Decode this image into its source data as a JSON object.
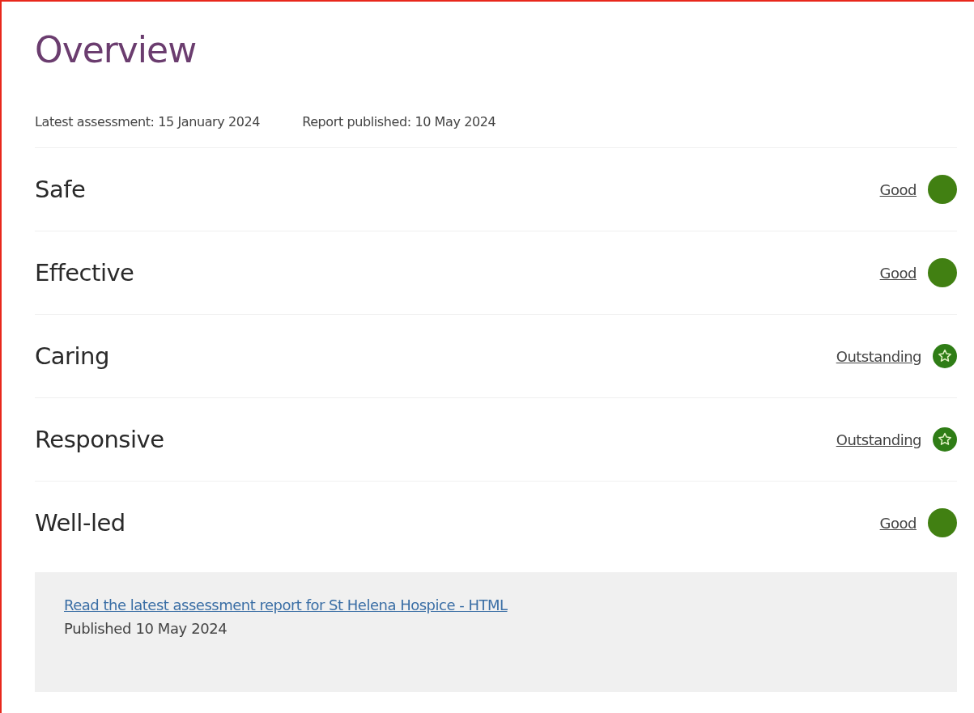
{
  "title": "Overview",
  "meta": [
    "Latest assessment: 15 January 2024",
    "Report published: 10 May 2024"
  ],
  "ratings": [
    {
      "area": "Safe",
      "rating": "Good",
      "kind": "good"
    },
    {
      "area": "Effective",
      "rating": "Good",
      "kind": "good"
    },
    {
      "area": "Caring",
      "rating": "Outstanding",
      "kind": "outstanding"
    },
    {
      "area": "Responsive",
      "rating": "Outstanding",
      "kind": "outstanding"
    },
    {
      "area": "Well-led",
      "rating": "Good",
      "kind": "good"
    }
  ],
  "report": {
    "link": "Read the latest assessment report for St Helena Hospice - HTML",
    "published": "Published 10 May 2024"
  }
}
